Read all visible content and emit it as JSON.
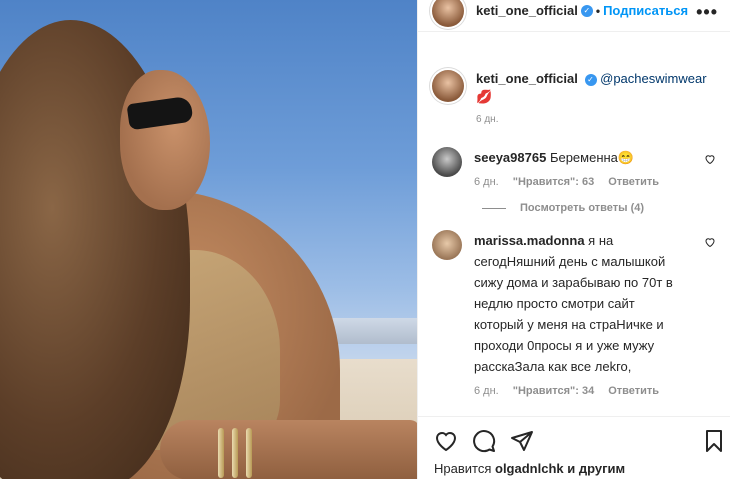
{
  "header": {
    "username": "keti_one_official",
    "separator": "•",
    "follow_label": "Подписаться",
    "more_label": "•••"
  },
  "caption": {
    "username": "keti_one_official",
    "mention": "@pacheswimwear",
    "emoji": "💋",
    "time": "6 дн."
  },
  "comments": [
    {
      "username": "seeya98765",
      "text": "Беременна😁",
      "time": "6 дн.",
      "likes": "\"Нравится\": 63",
      "reply": "Ответить"
    },
    {
      "username": "marissa.madonna",
      "text": "я на сегодНяшний день с малышкой сижу дома и зарабываю по 70т в недлю просто смотри сайт который у меня на страНичке и проходи 0просы я и уже мужу расскаЗала как все леkго,",
      "time": "6 дн.",
      "likes": "\"Нравится\": 34",
      "reply": "Ответить"
    }
  ],
  "view_replies": "Посмотреть ответы (4)",
  "likes_line": {
    "prefix": "Нравится",
    "user": "olgadnlchk",
    "suffix": "и другим"
  },
  "colors": {
    "accent": "#0095f6",
    "verified": "#3897f0",
    "muted": "#8e8e8e"
  }
}
